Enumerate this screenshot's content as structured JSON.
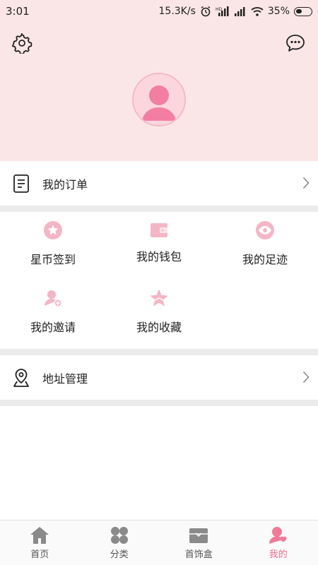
{
  "status_bar": {
    "time": "3:01",
    "network_speed": "15.3K/s",
    "battery": "35%",
    "icons": [
      "alarm-icon",
      "hd-signal-icon",
      "signal-icon",
      "wifi-icon",
      "battery-icon"
    ]
  },
  "header": {
    "settings_icon": "gear-icon",
    "messages_icon": "chat-bubble-icon",
    "avatar_icon": "default-avatar-icon"
  },
  "orders": {
    "label": "我的订单",
    "icon": "document-icon"
  },
  "grid": [
    {
      "label": "星币签到",
      "icon": "star-circle-icon"
    },
    {
      "label": "我的钱包",
      "icon": "wallet-icon"
    },
    {
      "label": "我的足迹",
      "icon": "eye-icon"
    },
    {
      "label": "我的邀请",
      "icon": "add-person-icon"
    },
    {
      "label": "我的收藏",
      "icon": "star-badge-icon"
    }
  ],
  "address": {
    "label": "地址管理",
    "icon": "map-pin-icon"
  },
  "bottom_nav": [
    {
      "label": "首页",
      "icon": "home-icon",
      "active": false
    },
    {
      "label": "分类",
      "icon": "category-icon",
      "active": false
    },
    {
      "label": "首饰盒",
      "icon": "jewelry-box-icon",
      "active": false
    },
    {
      "label": "我的",
      "icon": "profile-icon",
      "active": true
    }
  ],
  "colors": {
    "header_bg": "#fbe6e7",
    "accent": "#f07a98",
    "icon_pink": "#f4b6c6",
    "nav_inactive": "#888888"
  }
}
